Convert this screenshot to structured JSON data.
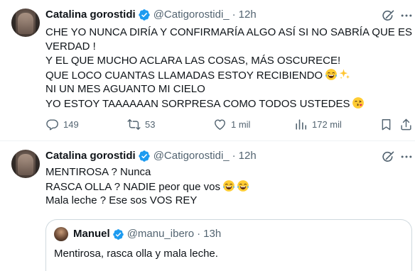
{
  "tweets": [
    {
      "author": "Catalina gorostidi",
      "handle": "@Catigorostidi_",
      "separator": "·",
      "time": "12h",
      "lines": [
        "CHE YO NUNCA DIRÍA Y CONFIRMARÍA ALGO ASÍ SI NO SABRÍA QUE ES",
        "VERDAD !",
        "Y EL QUE MUCHO ACLARA LAS COSAS, MÁS OSCURECE!",
        "QUE LOCO CUANTAS LLAMADAS ESTOY RECIBIENDO",
        "NI UN MES AGUANTO MI CIELO",
        "YO ESTOY TAAAAAAN SORPRESA COMO TODOS USTEDES"
      ],
      "emojis": {
        "line4": [
          "face-with-tears-of-joy",
          "sparkles"
        ],
        "line6": [
          "face-blowing-a-kiss"
        ]
      },
      "stats": {
        "replies": "149",
        "reposts": "53",
        "likes": "1 mil",
        "views": "172 mil"
      }
    },
    {
      "author": "Catalina gorostidi",
      "handle": "@Catigorostidi_",
      "separator": "·",
      "time": "12h",
      "lines": [
        "MENTIROSA ? Nunca",
        "RASCA OLLA ? NADIE peor que vos",
        "Mala leche ? Ese sos VOS REY"
      ],
      "emojis": {
        "line2": [
          "face-with-tears-of-joy",
          "face-with-tears-of-joy"
        ]
      },
      "quote": {
        "author": "Manuel",
        "handle": "@manu_ibero",
        "separator": "·",
        "time": "13h",
        "text": "Mentirosa, rasca olla y mala leche."
      }
    }
  ],
  "colors": {
    "text": "#0f1419",
    "secondary": "#536471",
    "verified": "#1d9bf0",
    "border": "#cfd9de"
  },
  "icons": [
    "grok-icon",
    "more-icon",
    "reply-icon",
    "repost-icon",
    "like-icon",
    "views-icon",
    "bookmark-icon",
    "share-icon",
    "verified-badge-icon"
  ]
}
